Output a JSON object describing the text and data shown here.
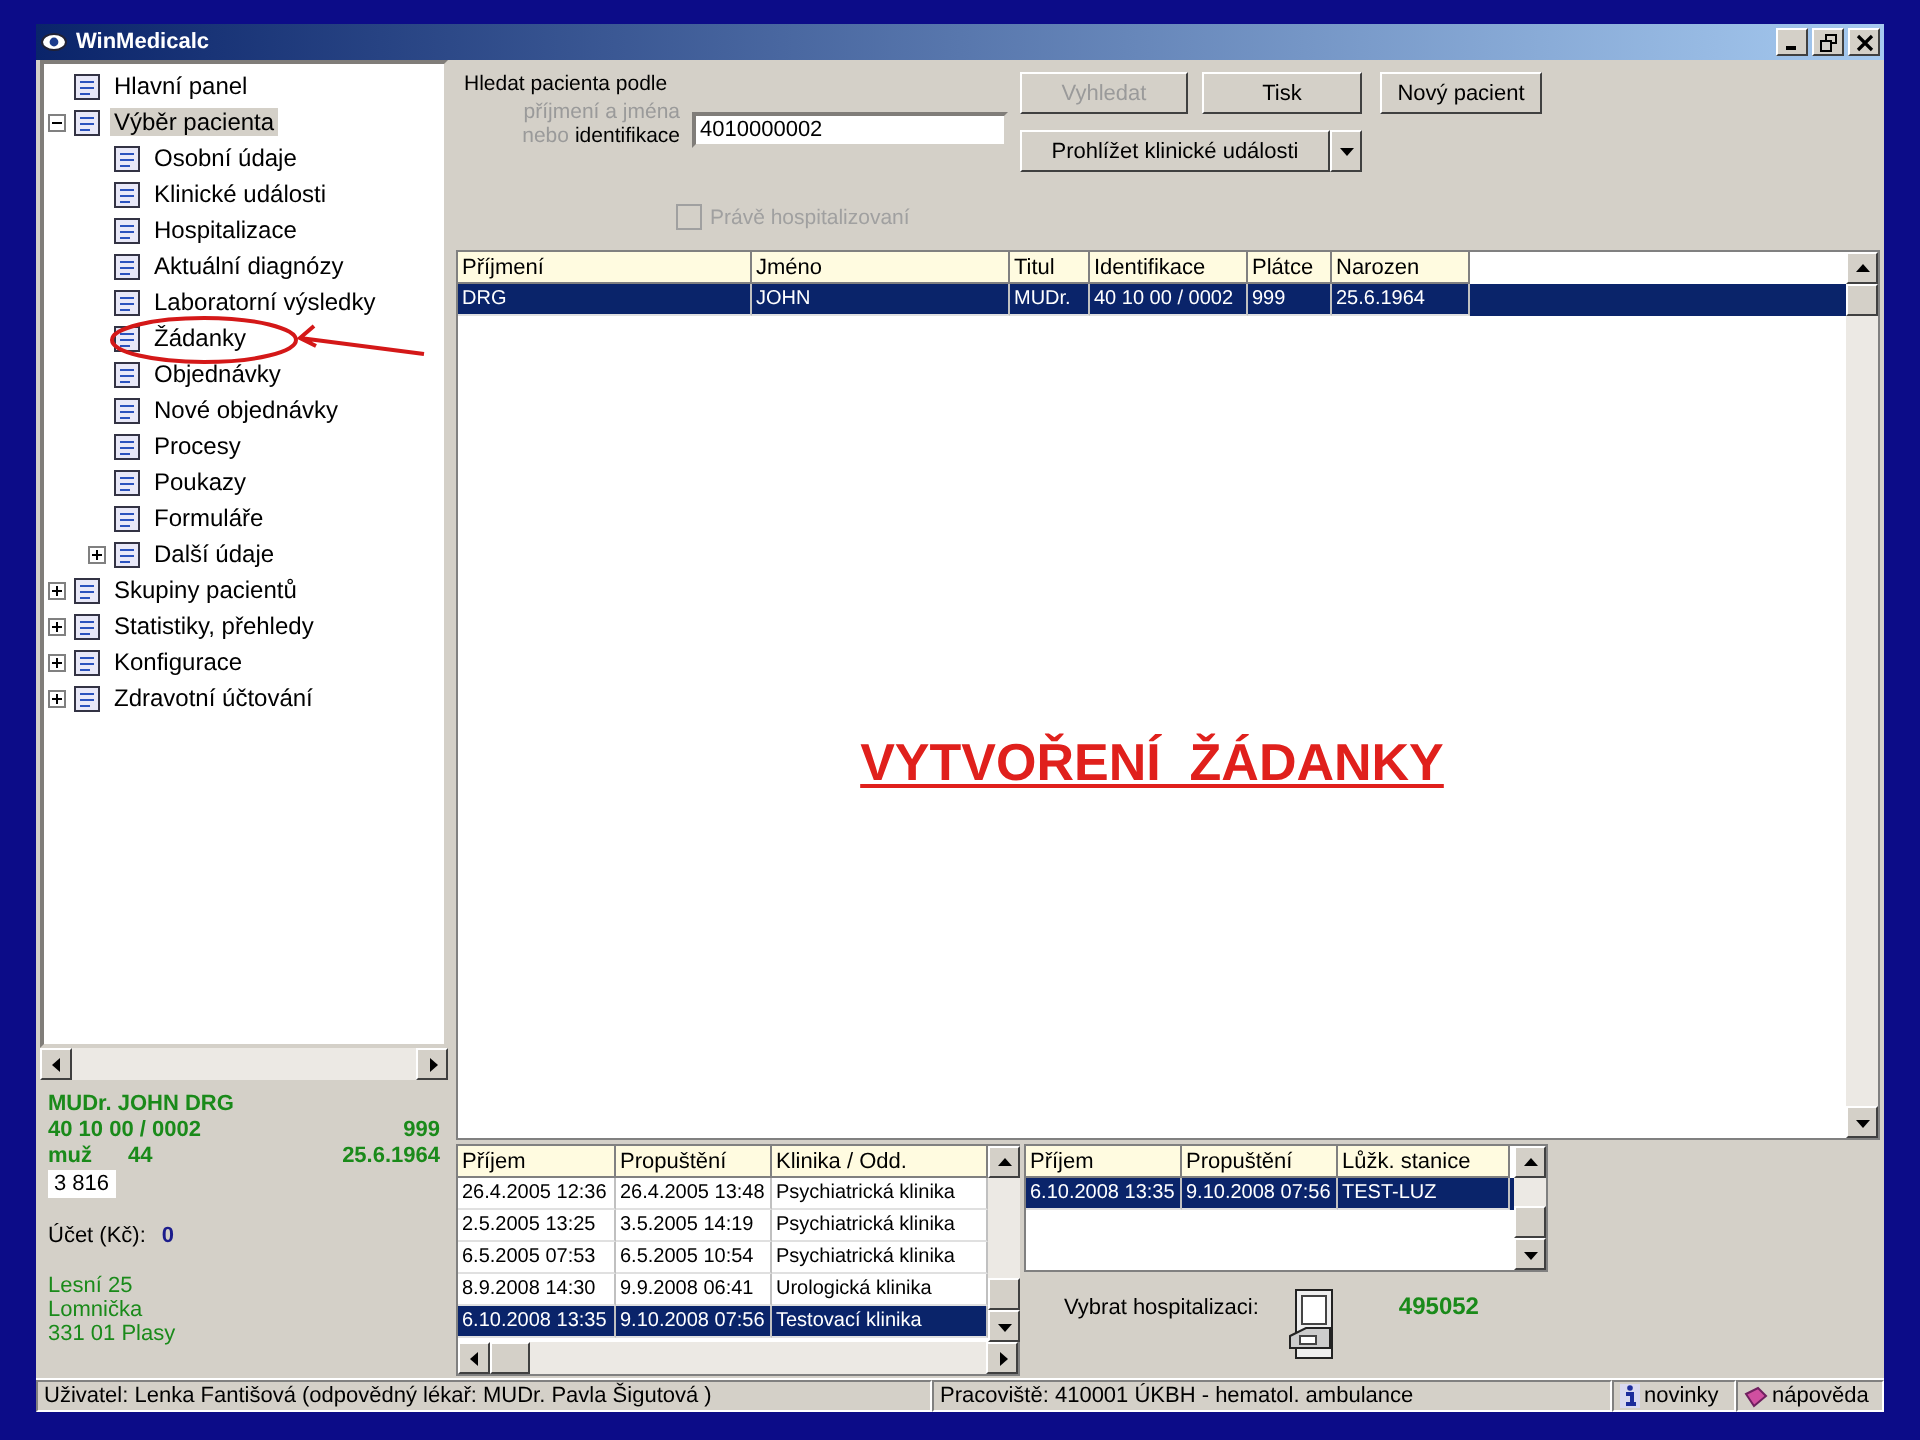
{
  "window": {
    "title": "WinMedicalc"
  },
  "tree": [
    {
      "label": "Hlavní panel",
      "kind": "leaf",
      "selected": false
    },
    {
      "label": "Výběr pacienta",
      "kind": "branch",
      "expanded": true,
      "selected": true,
      "children": [
        {
          "label": "Osobní údaje",
          "kind": "leaf",
          "selected": false
        },
        {
          "label": "Klinické události",
          "kind": "leaf",
          "selected": false
        },
        {
          "label": "Hospitalizace",
          "kind": "leaf",
          "selected": false
        },
        {
          "label": "Aktuální diagnózy",
          "kind": "leaf",
          "selected": false
        },
        {
          "label": "Laboratorní výsledky",
          "kind": "leaf",
          "selected": false
        },
        {
          "label": "Žádanky",
          "kind": "leaf",
          "selected": false
        },
        {
          "label": "Objednávky",
          "kind": "leaf",
          "selected": false
        },
        {
          "label": "Nové objednávky",
          "kind": "leaf",
          "selected": false
        },
        {
          "label": "Procesy",
          "kind": "leaf",
          "selected": false
        },
        {
          "label": "Poukazy",
          "kind": "leaf",
          "selected": false
        },
        {
          "label": "Formuláře",
          "kind": "leaf",
          "selected": false
        },
        {
          "label": "Další údaje",
          "kind": "branch",
          "expanded": false,
          "selected": false
        }
      ]
    },
    {
      "label": "Skupiny pacientů",
      "kind": "branch",
      "expanded": false,
      "selected": false
    },
    {
      "label": "Statistiky, přehledy",
      "kind": "branch",
      "expanded": false,
      "selected": false
    },
    {
      "label": "Konfigurace",
      "kind": "branch",
      "expanded": false,
      "selected": false
    },
    {
      "label": "Zdravotní účtování",
      "kind": "branch",
      "expanded": false,
      "selected": false
    }
  ],
  "patient_card": {
    "name": "MUDr. JOHN DRG",
    "identification": "40 10 00 / 0002",
    "payer": "999",
    "sex": "muž",
    "age": "44",
    "birth_date": "25.6.1964",
    "number": "3 816",
    "account_label": "Účet (Kč):",
    "account_value": "0",
    "address": [
      "Lesní 25",
      "Lomnička",
      "331 01 Plasy"
    ]
  },
  "search": {
    "title": "Hledat pacienta podle",
    "hint": "příjmení a jména",
    "hint_or": "nebo",
    "hint_active": "identifikace",
    "value": "4010000002"
  },
  "buttons": [
    {
      "label": "Vyhledat",
      "disabled": true
    },
    {
      "label": "Tisk",
      "disabled": false
    },
    {
      "label": "Nový pacient",
      "disabled": false
    }
  ],
  "events_button": {
    "label": "Prohlížet klinické události"
  },
  "checkbox": {
    "label": "Právě hospitalizovaní",
    "checked": false,
    "disabled": true
  },
  "patients_table": {
    "columns": [
      "Příjmení",
      "Jméno",
      "Titul",
      "Identifikace",
      "Plátce",
      "Narozen"
    ],
    "rows": [
      {
        "cells": [
          "DRG",
          "JOHN",
          "MUDr.",
          "40 10 00 / 0002",
          "999",
          "25.6.1964"
        ],
        "selected": true
      }
    ]
  },
  "annotation": {
    "text": "VYTVOŘENÍ  ŽÁDANKY"
  },
  "hospitalizations_table": {
    "columns": [
      "Příjem",
      "Propuštění",
      "Klinika / Odd."
    ],
    "rows": [
      {
        "cells": [
          "26.4.2005 12:36",
          "26.4.2005 13:48",
          "Psychiatrická klinika"
        ],
        "selected": false
      },
      {
        "cells": [
          "2.5.2005 13:25",
          "3.5.2005 14:19",
          "Psychiatrická klinika"
        ],
        "selected": false
      },
      {
        "cells": [
          "6.5.2005 07:53",
          "6.5.2005 10:54",
          "Psychiatrická klinika"
        ],
        "selected": false
      },
      {
        "cells": [
          "8.9.2008 14:30",
          "9.9.2008 06:41",
          "Urologická klinika"
        ],
        "selected": false
      },
      {
        "cells": [
          "6.10.2008 13:35",
          "9.10.2008 07:56",
          "Testovací klinika"
        ],
        "selected": true
      }
    ]
  },
  "beds_table": {
    "columns": [
      "Příjem",
      "Propuštění",
      "Lůžk. stanice"
    ],
    "rows": [
      {
        "cells": [
          "6.10.2008 13:35",
          "9.10.2008 07:56",
          "TEST-LUZ"
        ],
        "selected": true
      }
    ]
  },
  "hospitalization_pick": {
    "label": "Vybrat hospitalizaci:",
    "number": "495052"
  },
  "status_bar": {
    "user": "Uživatel: Lenka Fantišová (odpovědný lékař: MUDr. Pavla  Šigutová )",
    "workplace": "Pracoviště: 410001   ÚKBH - hematol. ambulance",
    "news": "novinky",
    "help": "nápověda"
  }
}
